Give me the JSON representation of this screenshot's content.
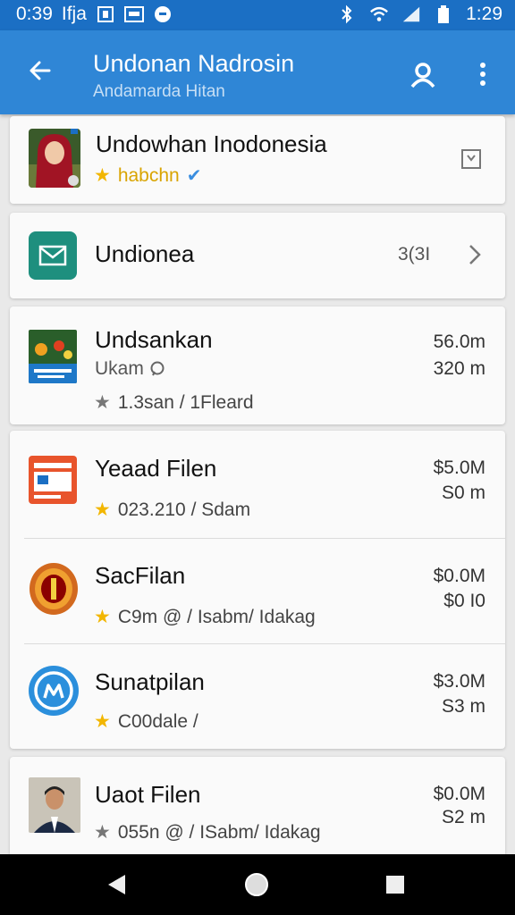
{
  "status_bar": {
    "time": "0:39",
    "left_text": "Ifja",
    "right_time": "1:29"
  },
  "app_bar": {
    "title": "Undonan Nadrosin",
    "subtitle": "Andamarda Hitan"
  },
  "profile": {
    "name": "Undowhan Inodonesia",
    "tag": "habchn"
  },
  "mail_row": {
    "label": "Undionea",
    "count": "3(3I"
  },
  "listings": [
    {
      "title": "Undsankan",
      "subtitle": "Ukam",
      "rating": "1.3san / 1Fleard",
      "value1": "56.0m",
      "value2": "320 m"
    },
    {
      "title": "Yeaad Filen",
      "rating": "023.210 / Sdam",
      "value1": "$5.0M",
      "value2": "S0 m"
    },
    {
      "title": "SacFilan",
      "rating": "C9m @ / Isabm/ Idakag",
      "value1": "$0.0M",
      "value2": "$0 I0"
    },
    {
      "title": "Sunatpilan",
      "rating": "C00dale /",
      "value1": "$3.0M",
      "value2": "S3 m"
    },
    {
      "title": "Uaot Filen",
      "rating": "055n @ / ISabm/ Idakag",
      "value1": "$0.0M",
      "value2": "S2 m"
    }
  ],
  "colors": {
    "status_bar": "#1b6fc4",
    "app_bar": "#2f86d6",
    "mail_icon": "#1e8f7e",
    "star": "#f2b600"
  }
}
